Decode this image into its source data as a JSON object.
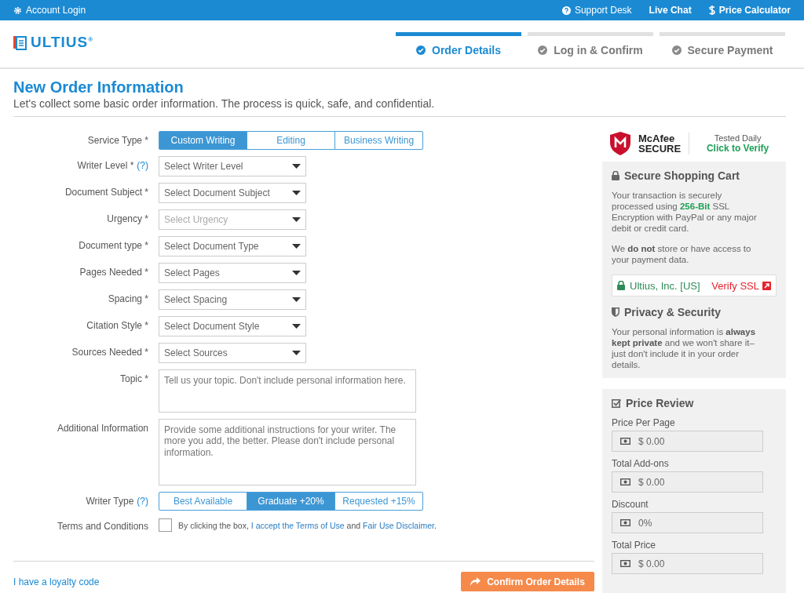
{
  "top_bar": {
    "left": {
      "label": "Account Login"
    },
    "right": [
      {
        "label": "Support Desk"
      },
      {
        "label": "Live Chat"
      },
      {
        "label": "Price Calculator"
      }
    ]
  },
  "header": {
    "logo": "ULTIUS$^{®}$",
    "steps": [
      {
        "label": "Order Details",
        "selected": true
      },
      {
        "label": "Log in & Confirm",
        "selected": false
      },
      {
        "label": "Secure Payment",
        "selected": false
      }
    ]
  },
  "title": "New Order Information",
  "subtitle": "Let's collect some basic order information. The process is quick, safe, and confidential.",
  "form": [
    {
      "kind": "segmented",
      "label": "Service Type *",
      "options": [
        {
          "label": "Custom Writing",
          "selected": true
        },
        {
          "label": "Editing",
          "selected": false
        },
        {
          "label": "Business Writing",
          "selected": false
        }
      ]
    },
    {
      "kind": "select",
      "label": "Writer Level *",
      "help": "(?)",
      "placeholder": "Select Writer Level",
      "disabled": false
    },
    {
      "kind": "select",
      "label": "Document Subject *",
      "placeholder": "Select Document Subject",
      "disabled": false
    },
    {
      "kind": "select",
      "label": "Urgency *",
      "placeholder": "Select Urgency",
      "disabled": true
    },
    {
      "kind": "select",
      "label": "Document type *",
      "placeholder": "Select Document Type",
      "disabled": false
    },
    {
      "kind": "select",
      "label": "Pages Needed *",
      "placeholder": "Select Pages",
      "disabled": false
    },
    {
      "kind": "select",
      "label": "Spacing *",
      "placeholder": "Select Spacing",
      "disabled": false
    },
    {
      "kind": "select",
      "label": "Citation Style *",
      "placeholder": "Select Document Style",
      "disabled": false
    },
    {
      "kind": "select",
      "label": "Sources Needed *",
      "placeholder": "Select Sources",
      "disabled": false
    },
    {
      "kind": "textarea",
      "label": "Topic *",
      "placeholder": "Tell us your topic. Don't include personal information here."
    },
    {
      "kind": "textarea",
      "label": "Additional Information",
      "placeholder": "Provide some additional instructions for your writer. The more you add, the better. Please don't include personal information."
    },
    {
      "kind": "segmented",
      "label": "Writer Type",
      "help": "(?)",
      "options": [
        {
          "label": "Best Available",
          "selected": false
        },
        {
          "label": "Graduate +20%",
          "selected": true
        },
        {
          "label": "Requested +15%",
          "selected": false
        }
      ]
    },
    {
      "kind": "checkbox",
      "label": "Terms and Conditions",
      "checked": false,
      "text_before": "By clicking the box, ",
      "link_1": "I accept the Terms of Use",
      "text_middle": " and ",
      "link_2": "Fair Use Disclaimer",
      "text_after": "."
    }
  ],
  "footer": {
    "loyalty_link": "I have a loyalty code",
    "confirm_button": "Confirm Order Details"
  },
  "sidebar": {
    "badge": {
      "brand_top": "McAfee",
      "brand_bottom": "SECURE",
      "tested": "Tested Daily",
      "verify": "Click to Verify"
    },
    "cart": {
      "title": "Secure Shopping Cart",
      "paragraphs": [
        {
          "text": "Your transaction is securely processed using **256-Bit** SSL Encryption with PayPal or any major debit or credit card."
        },
        {
          "text": "We **do not** store or have access to your payment data."
        }
      ],
      "ssl": {
        "company": "Ultius, Inc. [US]",
        "verify": "Verify SSL"
      }
    },
    "privacy": {
      "title": "Privacy & Security",
      "text": "Your personal information is **always kept private** and we won't share it–just don't include it in your order details."
    },
    "price_review": {
      "title": "Price Review",
      "fields": [
        {
          "label": "Price Per Page",
          "value": "$ 0.00"
        },
        {
          "label": "Total Add-ons",
          "value": "$ 0.00"
        },
        {
          "label": "Discount",
          "value": "0%"
        },
        {
          "label": "Total Price",
          "value": "$ 0.00"
        }
      ]
    }
  }
}
